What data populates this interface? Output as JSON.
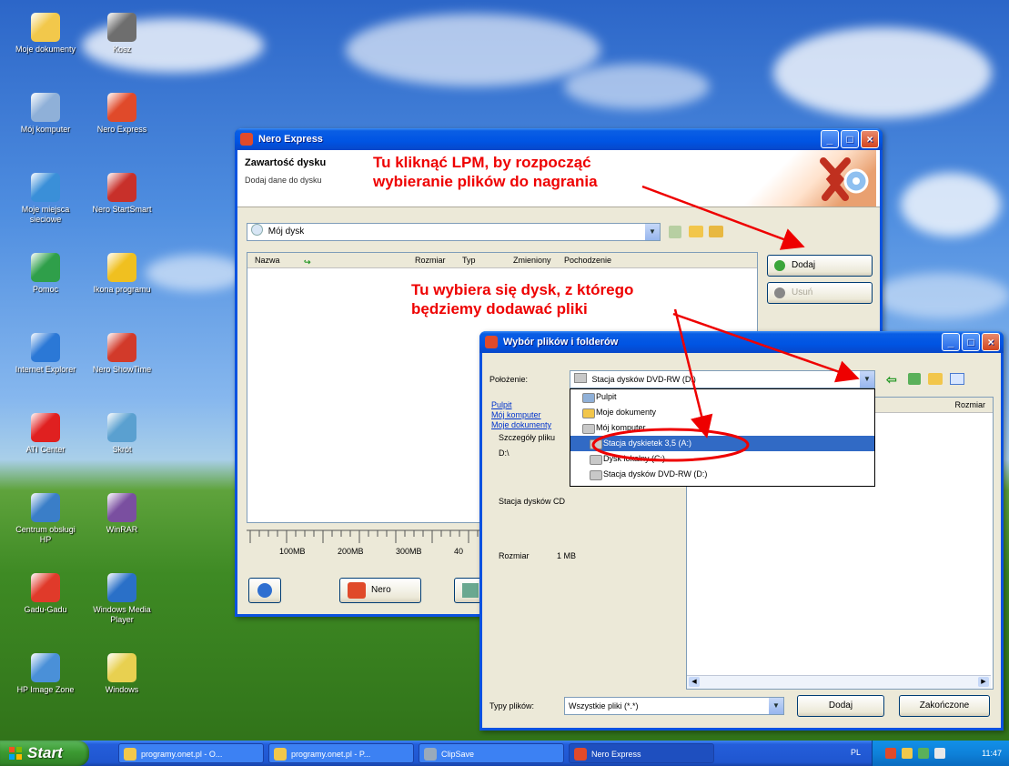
{
  "desktop": {
    "icons": [
      {
        "label": "Moje dokumenty",
        "color": "#f2c84b"
      },
      {
        "label": "Kosz",
        "color": "#6e6e6e"
      },
      {
        "label": "Mój komputer",
        "color": "#8fb0d8"
      },
      {
        "label": "Nero Express",
        "color": "#e04a2a"
      },
      {
        "label": "Moje miejsca sieciowe",
        "color": "#3a8fd8"
      },
      {
        "label": "Nero StartSmart",
        "color": "#c8302a"
      },
      {
        "label": "Pomoc",
        "color": "#2f9f4a"
      },
      {
        "label": "Ikona programu",
        "color": "#f0c020"
      },
      {
        "label": "Internet Explorer",
        "color": "#2b78d6"
      },
      {
        "label": "Nero ShowTime",
        "color": "#d23a2a"
      },
      {
        "label": "ATI Center",
        "color": "#e02020"
      },
      {
        "label": "Skrót",
        "color": "#5aa0d0"
      },
      {
        "label": "Centrum obsługi HP",
        "color": "#3a7ec8"
      },
      {
        "label": "WinRAR",
        "color": "#7a4fa0"
      },
      {
        "label": "Gadu-Gadu",
        "color": "#e03a2a"
      },
      {
        "label": "Windows Media Player",
        "color": "#2a70c8"
      },
      {
        "label": "HP Image Zone",
        "color": "#4a90d8"
      },
      {
        "label": "Windows",
        "color": "#e8d050"
      }
    ]
  },
  "nero": {
    "title": "Nero Express",
    "header_title": "Zawartość dysku",
    "header_sub": "Dodaj dane do dysku",
    "disc_name": "Mój dysk",
    "columns": [
      "Nazwa",
      "Rozmiar",
      "Typ",
      "Zmieniony",
      "Pochodzenie"
    ],
    "add_button": "Dodaj",
    "delete_button": "Usuń",
    "ruler_ticks": [
      "100MB",
      "200MB",
      "300MB",
      "40"
    ],
    "nero_button": "Nero"
  },
  "annotations": {
    "note1_line1": "Tu kliknąć LPM, by rozpocząć",
    "note1_line2": "wybieranie plików do nagrania",
    "note2_line1": "Tu wybiera się dysk, z którego",
    "note2_line2": "będziemy dodawać pliki"
  },
  "dialog": {
    "title": "Wybór plików i folderów",
    "location_label": "Położenie:",
    "location_value": "Stacja dysków DVD-RW (D:)",
    "dropdown_items": [
      {
        "label": "Pulpit",
        "selected": false
      },
      {
        "label": "Moje dokumenty",
        "selected": false
      },
      {
        "label": "Mój komputer",
        "selected": false
      },
      {
        "label": "Stacja dyskietek 3,5 (A:)",
        "selected": true
      },
      {
        "label": "Dysk lokalny (C:)",
        "selected": false
      },
      {
        "label": "Stacja dysków DVD-RW (D:)",
        "selected": false
      }
    ],
    "side_links": [
      "Pulpit",
      "Mój komputer",
      "Moje dokumenty"
    ],
    "details_label": "Szczegóły pliku",
    "path_value": "D:\\",
    "drive_type": "Stacja dysków CD",
    "size_label": "Rozmiar",
    "size_value": "1 MB",
    "column_size": "Rozmiar",
    "filetype_label": "Typy plików:",
    "filetype_value": "Wszystkie pliki (*.*)",
    "add_button": "Dodaj",
    "close_button": "Zakończone"
  },
  "taskbar": {
    "start": "Start",
    "buttons": [
      "programy.onet.pl - O...",
      "programy.onet.pl - P...",
      "ClipSave",
      "Nero Express"
    ],
    "lang": "PL",
    "time": "11:47"
  }
}
